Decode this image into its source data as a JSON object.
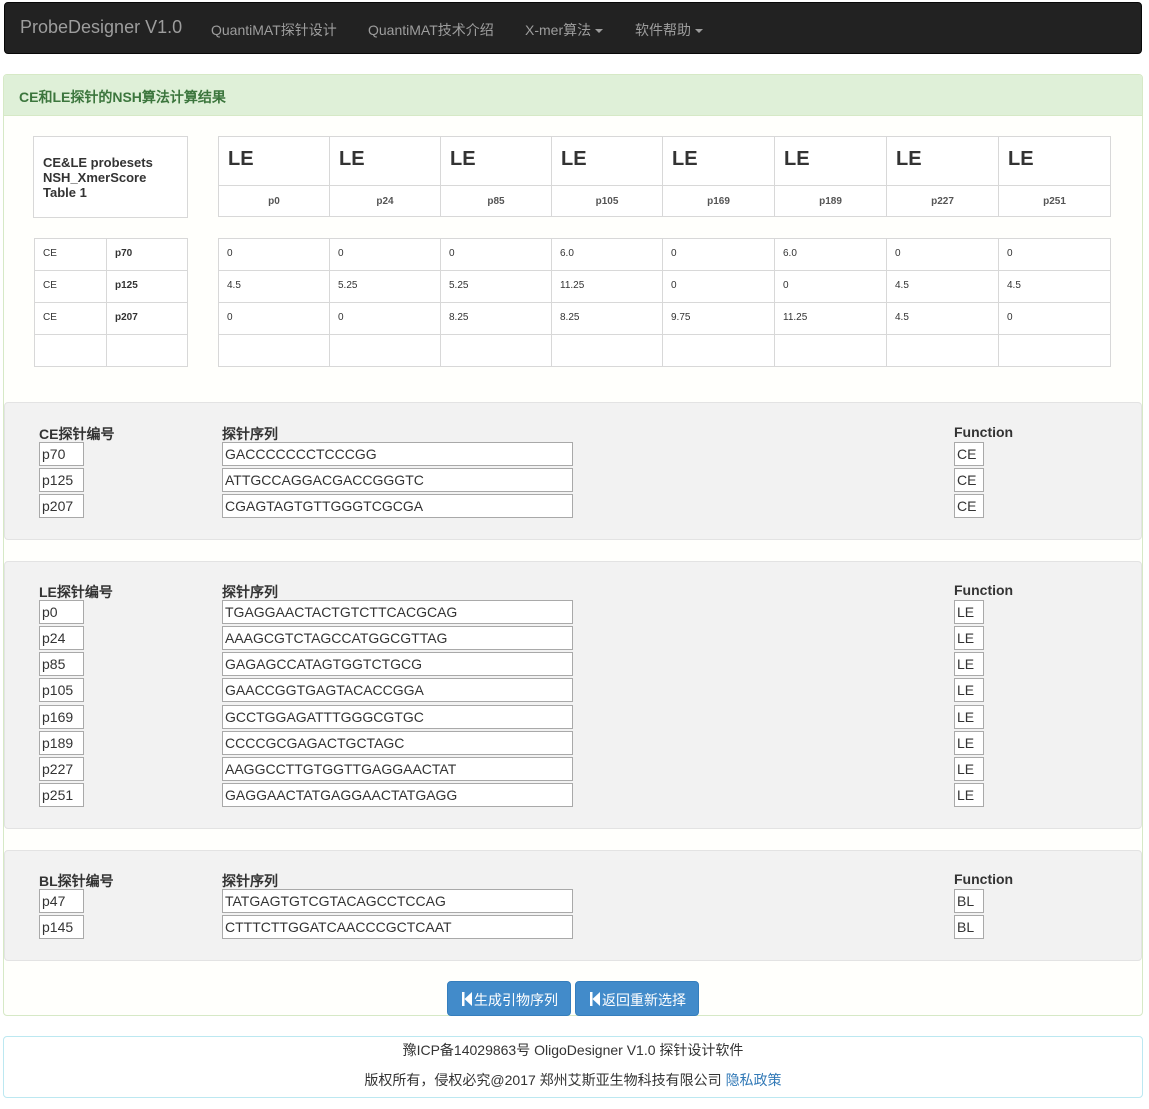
{
  "nav": {
    "brand": "ProbeDesigner V1.0",
    "items": [
      "QuantiMAT探针设计",
      "QuantiMAT技术介绍",
      "X-mer算法",
      "软件帮助"
    ]
  },
  "panel": {
    "title": "CE和LE探针的NSH算法计算结果"
  },
  "matrix": {
    "corner": [
      "CE&LE probesets",
      "NSH_XmerScore",
      "Table 1"
    ],
    "le_header": "LE",
    "columns": [
      "p0",
      "p24",
      "p85",
      "p105",
      "p169",
      "p189",
      "p227",
      "p251"
    ],
    "rows": [
      {
        "type": "CE",
        "probe": "p70",
        "values": [
          "0",
          "0",
          "0",
          "6.0",
          "0",
          "6.0",
          "0",
          "0"
        ]
      },
      {
        "type": "CE",
        "probe": "p125",
        "values": [
          "4.5",
          "5.25",
          "5.25",
          "11.25",
          "0",
          "0",
          "4.5",
          "4.5"
        ]
      },
      {
        "type": "CE",
        "probe": "p207",
        "values": [
          "0",
          "0",
          "8.25",
          "8.25",
          "9.75",
          "11.25",
          "4.5",
          "0"
        ]
      },
      {
        "type": "",
        "probe": "",
        "values": [
          "",
          "",
          "",
          "",
          "",
          "",
          "",
          ""
        ]
      }
    ]
  },
  "ce_section": {
    "id_header": "CE探针编号",
    "seq_header": "探针序列",
    "func_header": "Function",
    "rows": [
      {
        "id": "p70",
        "seq": "GACCCCCCCTCCCGG",
        "func": "CE"
      },
      {
        "id": "p125",
        "seq": "ATTGCCAGGACGACCGGGTC",
        "func": "CE"
      },
      {
        "id": "p207",
        "seq": "CGAGTAGTGTTGGGTCGCGA",
        "func": "CE"
      }
    ]
  },
  "le_section": {
    "id_header": "LE探针编号",
    "seq_header": "探针序列",
    "func_header": "Function",
    "rows": [
      {
        "id": "p0",
        "seq": "TGAGGAACTACTGTCTTCACGCAG",
        "func": "LE"
      },
      {
        "id": "p24",
        "seq": "AAAGCGTCTAGCCATGGCGTTAG",
        "func": "LE"
      },
      {
        "id": "p85",
        "seq": "GAGAGCCATAGTGGTCTGCG",
        "func": "LE"
      },
      {
        "id": "p105",
        "seq": "GAACCGGTGAGTACACCGGA",
        "func": "LE"
      },
      {
        "id": "p169",
        "seq": "GCCTGGAGATTTGGGCGTGC",
        "func": "LE"
      },
      {
        "id": "p189",
        "seq": "CCCCGCGAGACTGCTAGC",
        "func": "LE"
      },
      {
        "id": "p227",
        "seq": "AAGGCCTTGTGGTTGAGGAACTAT",
        "func": "LE"
      },
      {
        "id": "p251",
        "seq": "GAGGAACTATGAGGAACTATGAGG",
        "func": "LE"
      }
    ]
  },
  "bl_section": {
    "id_header": "BL探针编号",
    "seq_header": "探针序列",
    "func_header": "Function",
    "rows": [
      {
        "id": "p47",
        "seq": "TATGAGTGTCGTACAGCCTCCAG",
        "func": "BL"
      },
      {
        "id": "p145",
        "seq": "CTTTCTTGGATCAACCCGCTCAAT",
        "func": "BL"
      }
    ]
  },
  "buttons": {
    "generate": "生成引物序列",
    "back": "返回重新选择"
  },
  "footer": {
    "line1": "豫ICP备14029863号 OligoDesigner V1.0 探针设计软件",
    "line2": "版权所有，侵权必究@2017 郑州艾斯亚生物科技有限公司",
    "privacy": "隐私政策"
  },
  "colors": {
    "navbar": "#222222",
    "heading_bg": "#dff0d8",
    "heading_text": "#3c763d",
    "primary": "#428bca"
  }
}
